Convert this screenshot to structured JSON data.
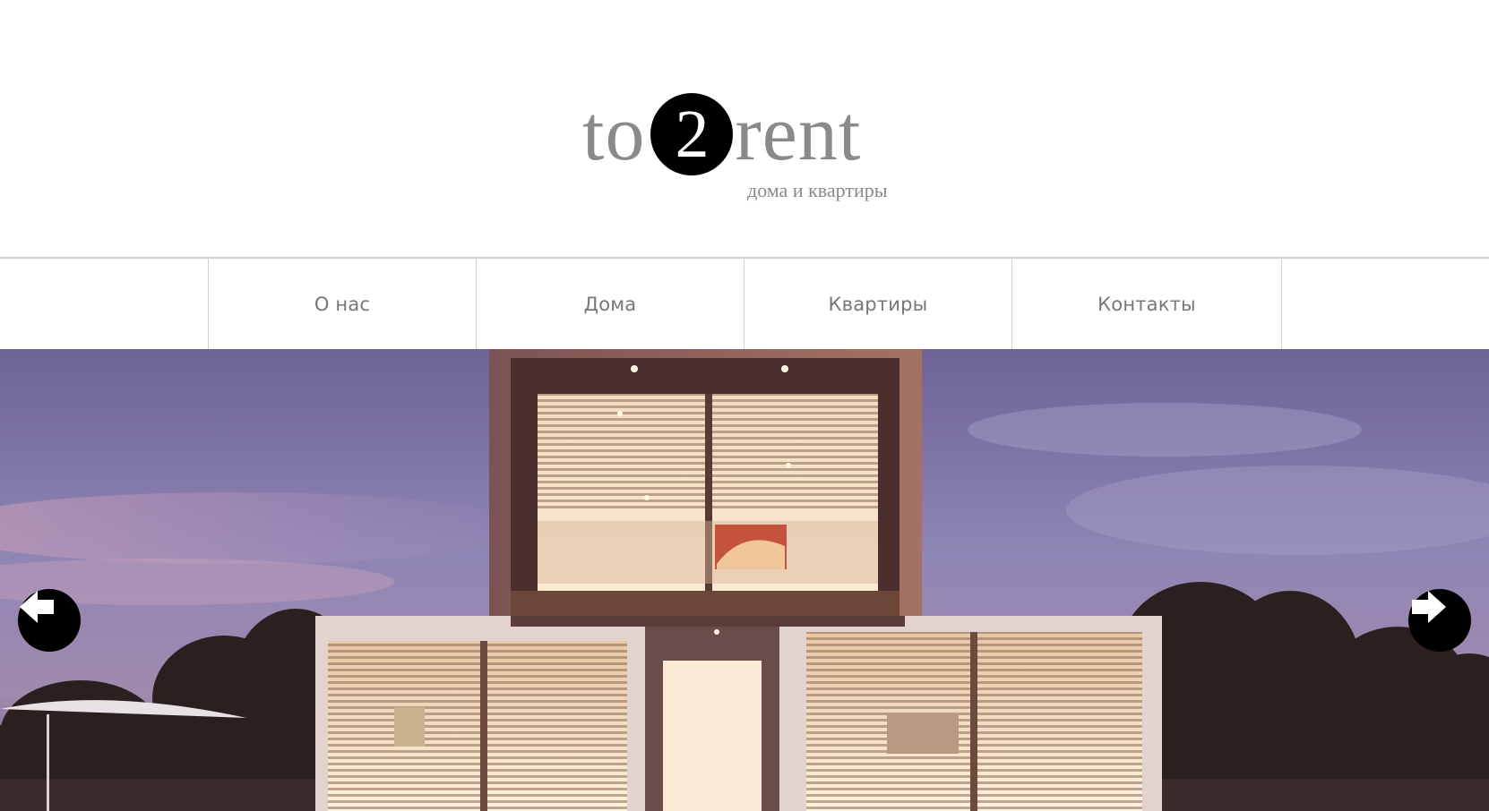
{
  "logo": {
    "word_left": "to",
    "circle_digit": "2",
    "word_right": "rent",
    "tagline": "дома и квартиры"
  },
  "nav": {
    "items": [
      {
        "label": "О нас"
      },
      {
        "label": "Дома"
      },
      {
        "label": "Квартиры"
      },
      {
        "label": "Контакты"
      }
    ]
  },
  "hero": {
    "image": "modern-house-at-dusk",
    "prev_icon": "arrow-left-icon",
    "next_icon": "arrow-right-icon"
  },
  "colors": {
    "logo_gray": "#8a8a8a",
    "nav_text": "#777777",
    "divider": "#cfcfcf",
    "arrow_bg": "#000000"
  }
}
